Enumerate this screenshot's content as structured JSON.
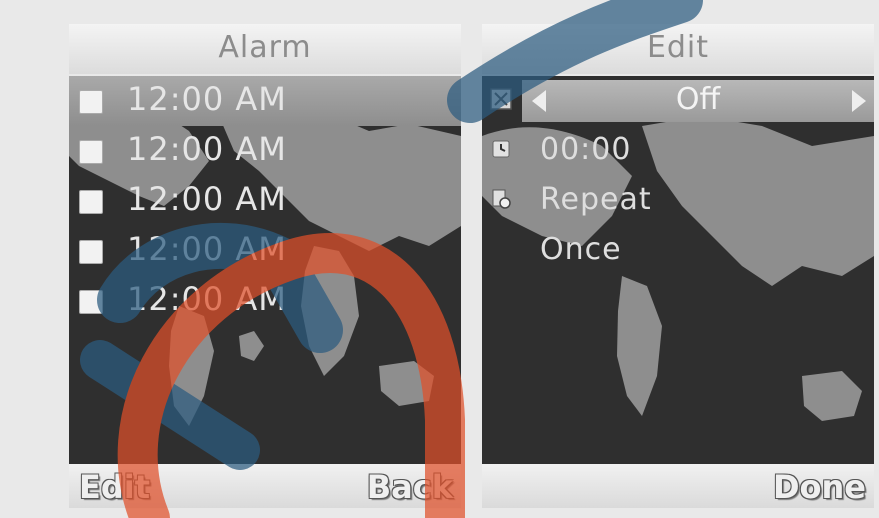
{
  "alarm_screen": {
    "title": "Alarm",
    "alarms": [
      {
        "time": "12:00 AM"
      },
      {
        "time": "12:00 AM"
      },
      {
        "time": "12:00 AM"
      },
      {
        "time": "12:00 AM"
      },
      {
        "time": "12:00 AM"
      }
    ],
    "softkeys": {
      "left": "Edit",
      "right": "Back"
    }
  },
  "edit_screen": {
    "title": "Edit",
    "status_value": "Off",
    "time_value": "00:00",
    "repeat_label": "Repeat",
    "repeat_value": "Once",
    "softkeys": {
      "right": "Done"
    }
  },
  "colors": {
    "map_water": "#2f2f2f",
    "map_land": "#8e8e8e",
    "selection": "#9a9a9a",
    "watermark_blue": "#2c5c80",
    "watermark_orange": "#e0502a"
  }
}
